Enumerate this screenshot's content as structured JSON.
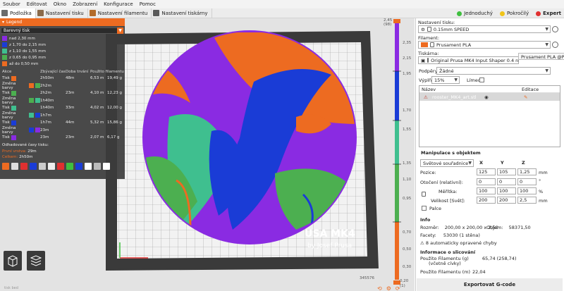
{
  "menu": [
    "Soubor",
    "Editovat",
    "Okno",
    "Zobrazení",
    "Konfigurace",
    "Pomoc"
  ],
  "tabs": [
    {
      "label": "Podložka",
      "icon": "plater-icon",
      "active": true
    },
    {
      "label": "Nastavení tisku",
      "icon": "print-settings-icon",
      "active": false
    },
    {
      "label": "Nastavení filamentu",
      "icon": "filament-settings-icon",
      "active": false
    },
    {
      "label": "Nastavení tiskárny",
      "icon": "printer-settings-icon",
      "active": false
    }
  ],
  "modes": [
    {
      "label": "Jednoduchý",
      "color": "#3fbf3f"
    },
    {
      "label": "Pokročilý",
      "color": "#f0c419"
    },
    {
      "label": "Expert",
      "color": "#e03030"
    }
  ],
  "legend": {
    "title": "Legend",
    "view_type": "Barevný tisk",
    "ranges": [
      {
        "label": "nad 2,30 mm",
        "color": "#8a2be2"
      },
      {
        "label": "z 1,70 do 2,15 mm",
        "color": "#1a3cd6"
      },
      {
        "label": "z 1,10 do 1,55 mm",
        "color": "#3fbf8f"
      },
      {
        "label": "z 0,65 do 0,95 mm",
        "color": "#4caf50"
      },
      {
        "label": "až do 0,50 mm",
        "color": "#ed6b21"
      }
    ],
    "headers": [
      "Akce",
      "Zbývající čas",
      "Doba trvání",
      "Použito filamentu"
    ],
    "rows": [
      {
        "action": "Tisk",
        "colors": [
          "#ed6b21"
        ],
        "remaining": "2h50m",
        "duration": "48m",
        "length": "6,53 m",
        "weight": "19,49 g"
      },
      {
        "action": "Změna barvy",
        "colors": [
          "#ed6b21",
          "#4caf50"
        ],
        "remaining": "2h2m",
        "duration": "",
        "length": "",
        "weight": ""
      },
      {
        "action": "Tisk",
        "colors": [
          "#4caf50"
        ],
        "remaining": "2h2m",
        "duration": "23m",
        "length": "4,10 m",
        "weight": "12,23 g"
      },
      {
        "action": "Změna barvy",
        "colors": [
          "#4caf50",
          "#3fbf8f"
        ],
        "remaining": "1h40m",
        "duration": "",
        "length": "",
        "weight": ""
      },
      {
        "action": "Tisk",
        "colors": [
          "#3fbf8f"
        ],
        "remaining": "1h40m",
        "duration": "33m",
        "length": "4,02 m",
        "weight": "12,00 g"
      },
      {
        "action": "Změna barvy",
        "colors": [
          "#3fbf8f",
          "#1a3cd6"
        ],
        "remaining": "1h7m",
        "duration": "",
        "length": "",
        "weight": ""
      },
      {
        "action": "Tisk",
        "colors": [
          "#1a3cd6"
        ],
        "remaining": "1h7m",
        "duration": "44m",
        "length": "5,32 m",
        "weight": "15,86 g"
      },
      {
        "action": "Změna barvy",
        "colors": [
          "#1a3cd6",
          "#8a2be2"
        ],
        "remaining": "23m",
        "duration": "",
        "length": "",
        "weight": ""
      },
      {
        "action": "Tisk",
        "colors": [
          "#8a2be2"
        ],
        "remaining": "23m",
        "duration": "23m",
        "length": "2,07 m",
        "weight": "6,17 g"
      }
    ],
    "estimated_title": "Odhadované časy tisku:",
    "first_layer_label": "První vrstva:",
    "first_layer_value": "29m",
    "total_label": "Celkem:",
    "total_value": "2h50m"
  },
  "bed": {
    "brand_text": "USA MK4",
    "byline": "by Josef Prusa"
  },
  "layer_slider": {
    "top_value": "2,45",
    "top_sub": "(98)",
    "ticks": [
      "2,35",
      "2,15",
      "1,95",
      "1,70",
      "1,55",
      "1,35",
      "1,10",
      "0,95",
      "0,70",
      "0,50",
      "0,30"
    ],
    "bottom_value": "0,20",
    "bottom_sub": "(1)",
    "move_value": "345576"
  },
  "bottom_left_label": "tisk bed",
  "right_panel": {
    "print_settings_label": "Nastavení tisku:",
    "print_settings_value": "0.15mm SPEED",
    "filament_label": "Filament:",
    "filament_value": "Prusament PLA",
    "filament_color": "#ed6b21",
    "printer_label": "Tiskárna:",
    "printer_value": "Original Prusa MK4 Input Shaper 0.4 nozzle",
    "tooltip": "Prusament PLA @PGIS",
    "supports_label": "Podpěry:",
    "supports_value": "Žádné",
    "infill_label": "Výplň:",
    "infill_value": "15%",
    "brim_label": "Límec:",
    "list_name_header": "Název",
    "list_edit_header": "Editace",
    "object_name": "rooster_MK4_art.stl",
    "manip_title": "Manipulace s objektem",
    "coord_value": "Světové souřadnice",
    "axis_x": "X",
    "axis_y": "Y",
    "axis_z": "Z",
    "position_label": "Pozice:",
    "position": [
      "125",
      "105",
      "1,25"
    ],
    "position_unit": "mm",
    "rotation_label": "Otočení (relativní):",
    "rotation": [
      "0",
      "0",
      "0"
    ],
    "rotation_unit": "°",
    "scale_label": "Měřítka:",
    "scale": [
      "100",
      "100",
      "100"
    ],
    "scale_unit": "%",
    "size_label": "Velikost [Svět]:",
    "size": [
      "200",
      "200",
      "2,5"
    ],
    "size_unit": "mm",
    "inches_label": "Palce",
    "info_title": "Info",
    "size_info_label": "Rozměr:",
    "size_info_value": "200,00 x 200,00 x 2,50",
    "volume_label": "Objem:",
    "volume_value": "58371,50",
    "facets_label": "Facety:",
    "facets_value": "53030 (1 stěna)",
    "errors_text": "8 automaticky opravené chyby",
    "slice_title": "Informace o slicování",
    "filament_g_label": "Použito Filamentu (g)",
    "filament_g_sub": "(včetně cívky)",
    "filament_g_value": "65,74 (258,74)",
    "filament_m_label": "Použito Filamentu (m)",
    "filament_m_value": "22,04",
    "export_label": "Exportovat G-code"
  }
}
